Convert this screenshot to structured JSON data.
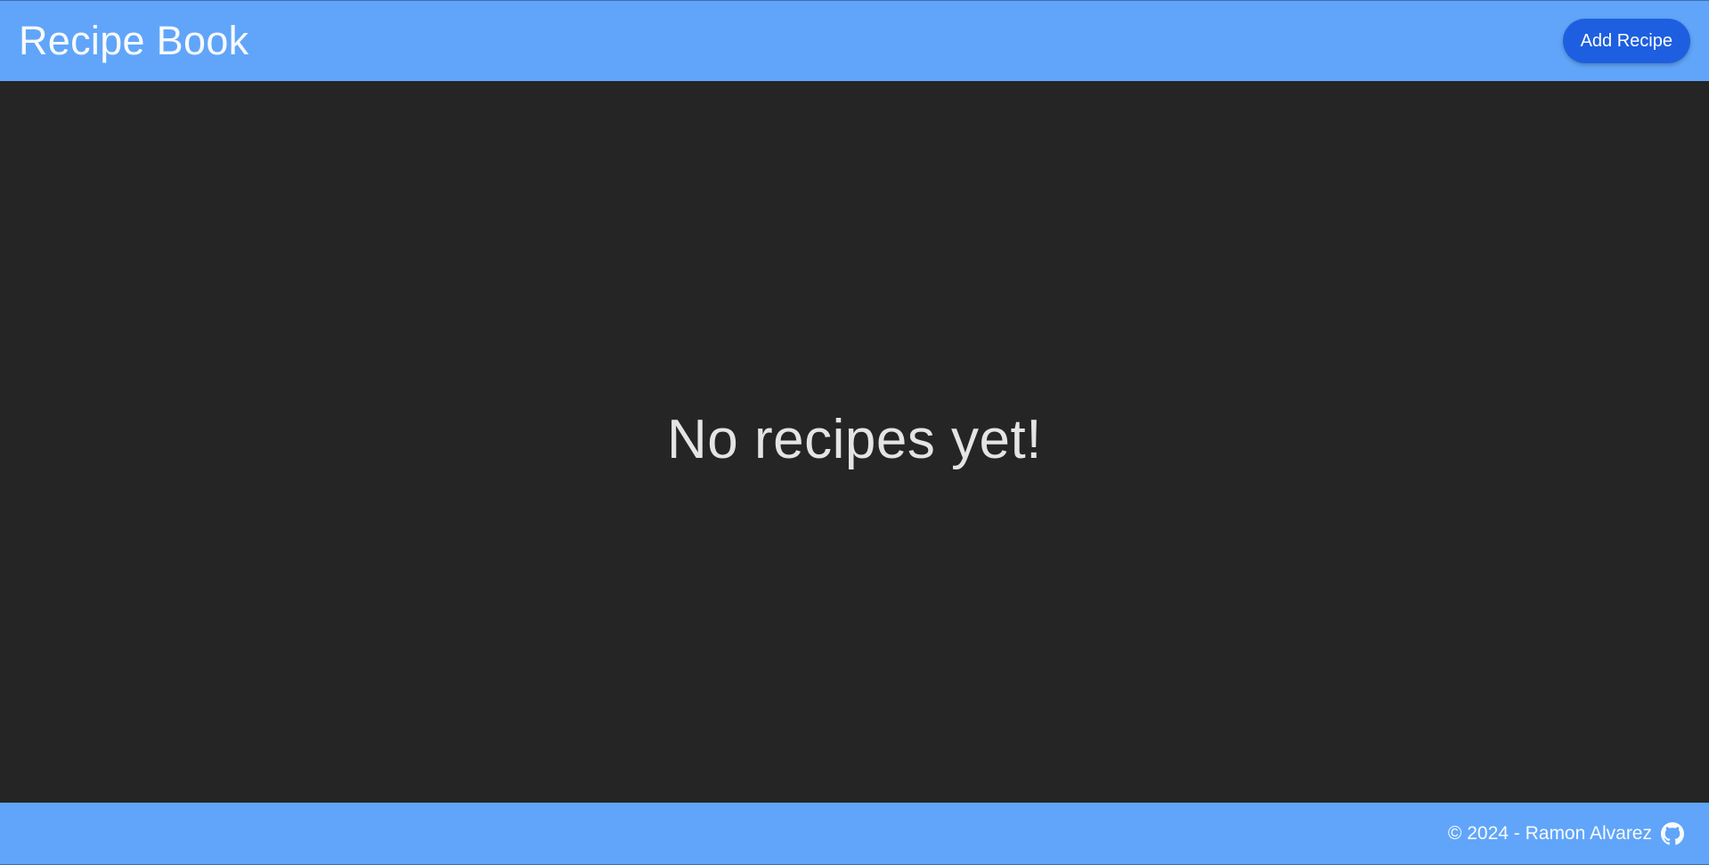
{
  "header": {
    "title": "Recipe Book",
    "add_button_label": "Add Recipe"
  },
  "main": {
    "empty_message": "No recipes yet!"
  },
  "footer": {
    "copyright": "© 2024 - Ramon Alvarez",
    "link_icon": "github-icon"
  },
  "colors": {
    "header_footer_bg": "#60a5fa",
    "main_bg": "#252525",
    "button_bg": "#1d5fe0",
    "text_light": "#f8fafc",
    "empty_text": "#e4e4e4"
  }
}
